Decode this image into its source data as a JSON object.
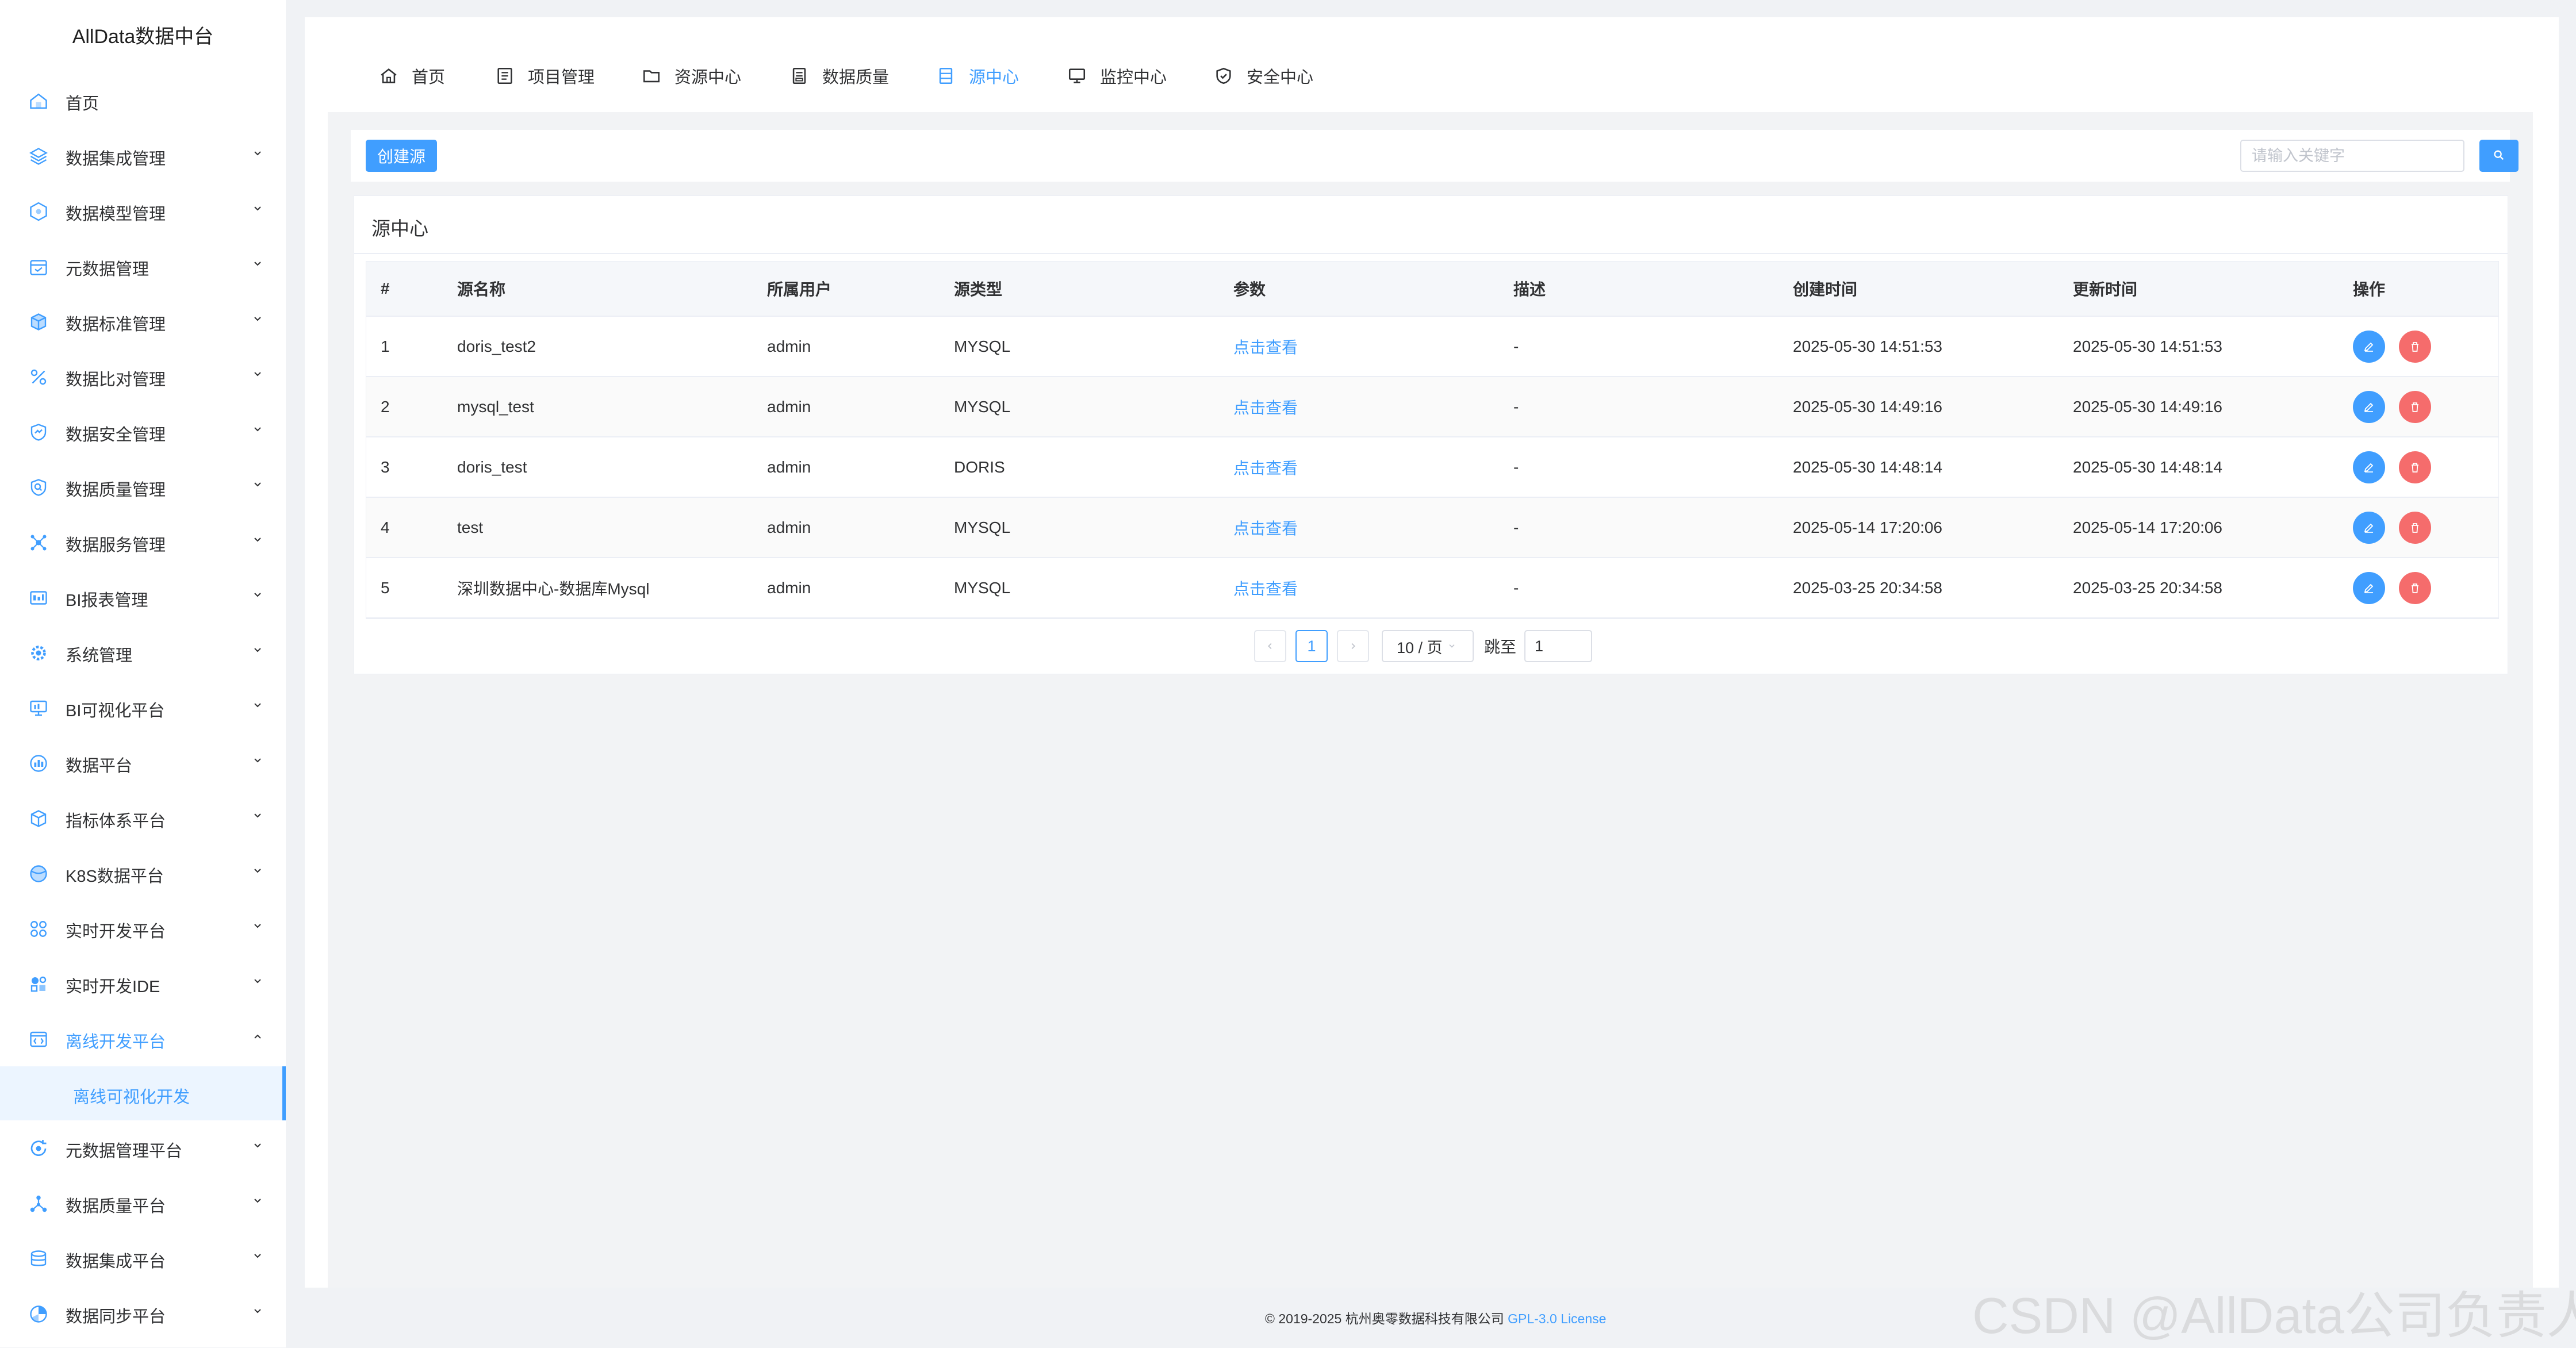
{
  "app": {
    "title": "AllData数据中台"
  },
  "sidebar": {
    "items": [
      {
        "label": "首页",
        "icon": "home-icon",
        "expandable": false
      },
      {
        "label": "数据集成管理",
        "icon": "layers-icon",
        "expandable": true
      },
      {
        "label": "数据模型管理",
        "icon": "hexagon-icon",
        "expandable": true
      },
      {
        "label": "元数据管理",
        "icon": "calendar-icon",
        "expandable": true
      },
      {
        "label": "数据标准管理",
        "icon": "box-icon",
        "expandable": true
      },
      {
        "label": "数据比对管理",
        "icon": "percent-icon",
        "expandable": true
      },
      {
        "label": "数据安全管理",
        "icon": "shield-chart-icon",
        "expandable": true
      },
      {
        "label": "数据质量管理",
        "icon": "search-shield-icon",
        "expandable": true
      },
      {
        "label": "数据服务管理",
        "icon": "network-icon",
        "expandable": true
      },
      {
        "label": "BI报表管理",
        "icon": "report-icon",
        "expandable": true
      },
      {
        "label": "系统管理",
        "icon": "settings-icon",
        "expandable": true
      },
      {
        "label": "BI可视化平台",
        "icon": "monitor-icon",
        "expandable": true
      },
      {
        "label": "数据平台",
        "icon": "chart-box-icon",
        "expandable": true
      },
      {
        "label": "指标体系平台",
        "icon": "cube-icon",
        "expandable": true
      },
      {
        "label": "K8S数据平台",
        "icon": "globe-icon",
        "expandable": true
      },
      {
        "label": "实时开发平台",
        "icon": "four-circles-icon",
        "expandable": true
      },
      {
        "label": "实时开发IDE",
        "icon": "shapes-icon",
        "expandable": true
      },
      {
        "label": "离线开发平台",
        "icon": "code-window-icon",
        "expandable": true,
        "open": true
      },
      {
        "label": "元数据管理平台",
        "icon": "refresh-icon",
        "expandable": true
      },
      {
        "label": "数据质量平台",
        "icon": "graph-icon",
        "expandable": true
      },
      {
        "label": "数据集成平台",
        "icon": "database-icon",
        "expandable": true
      },
      {
        "label": "数据同步平台",
        "icon": "pie-icon",
        "expandable": true
      }
    ],
    "active_sub": "离线可视化开发"
  },
  "topnav": {
    "tabs": [
      {
        "label": "首页",
        "icon": "home-icon"
      },
      {
        "label": "项目管理",
        "icon": "list-icon"
      },
      {
        "label": "资源中心",
        "icon": "folder-icon"
      },
      {
        "label": "数据质量",
        "icon": "document-icon"
      },
      {
        "label": "源中心",
        "icon": "datasource-icon",
        "active": true
      },
      {
        "label": "监控中心",
        "icon": "monitor-icon"
      },
      {
        "label": "安全中心",
        "icon": "shield-check-icon"
      }
    ]
  },
  "toolbar": {
    "create_label": "创建源",
    "search_placeholder": "请输入关键字"
  },
  "card": {
    "title": "源中心"
  },
  "table": {
    "headers": [
      "#",
      "源名称",
      "所属用户",
      "源类型",
      "参数",
      "描述",
      "创建时间",
      "更新时间",
      "操作"
    ],
    "rows": [
      {
        "idx": "1",
        "name": "doris_test2",
        "user": "admin",
        "type": "MYSQL",
        "param": "点击查看",
        "desc": "-",
        "created": "2025-05-30 14:51:53",
        "updated": "2025-05-30 14:51:53"
      },
      {
        "idx": "2",
        "name": "mysql_test",
        "user": "admin",
        "type": "MYSQL",
        "param": "点击查看",
        "desc": "-",
        "created": "2025-05-30 14:49:16",
        "updated": "2025-05-30 14:49:16"
      },
      {
        "idx": "3",
        "name": "doris_test",
        "user": "admin",
        "type": "DORIS",
        "param": "点击查看",
        "desc": "-",
        "created": "2025-05-30 14:48:14",
        "updated": "2025-05-30 14:48:14"
      },
      {
        "idx": "4",
        "name": "test",
        "user": "admin",
        "type": "MYSQL",
        "param": "点击查看",
        "desc": "-",
        "created": "2025-05-14 17:20:06",
        "updated": "2025-05-14 17:20:06"
      },
      {
        "idx": "5",
        "name": "深圳数据中心-数据库Mysql",
        "user": "admin",
        "type": "MYSQL",
        "param": "点击查看",
        "desc": "-",
        "created": "2025-03-25 20:34:58",
        "updated": "2025-03-25 20:34:58"
      }
    ]
  },
  "pagination": {
    "current_page": "1",
    "page_size": "10 / 页",
    "jump_label": "跳至",
    "jump_value": "1"
  },
  "footer": {
    "copyright": "© 2019-2025 杭州奥零数据科技有限公司",
    "license": "GPL-3.0 License"
  },
  "watermark": "CSDN @AllData公司负责人",
  "colors": {
    "primary": "#409eff",
    "danger": "#f56c6c",
    "text": "#303133",
    "placeholder": "#c0c4cc"
  }
}
